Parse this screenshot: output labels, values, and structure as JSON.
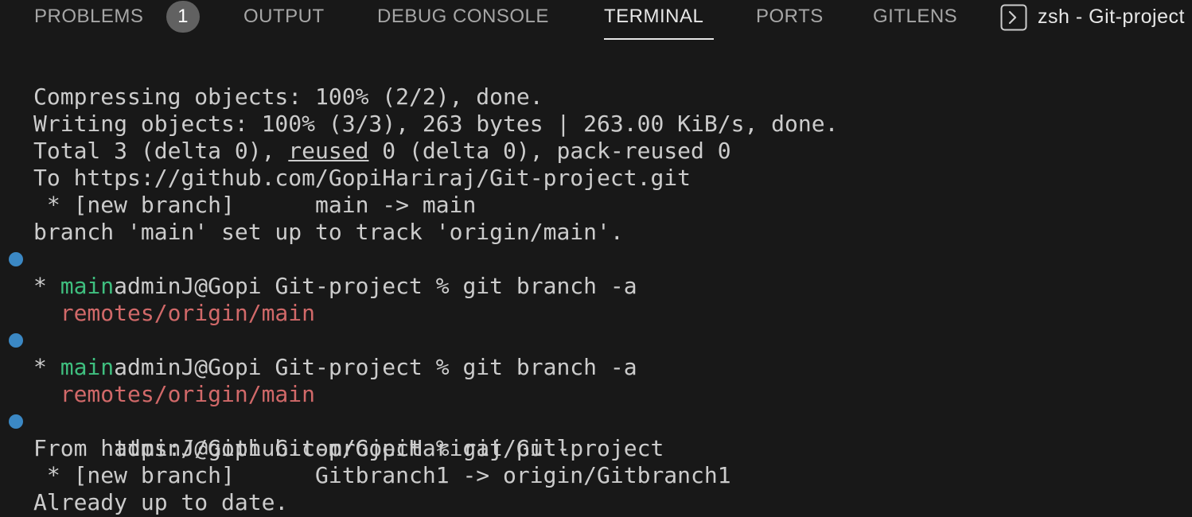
{
  "tabs": {
    "problems": "PROBLEMS",
    "problems_count": "1",
    "output": "OUTPUT",
    "debug_console": "DEBUG CONSOLE",
    "terminal": "TERMINAL",
    "ports": "PORTS",
    "gitlens": "GITLENS"
  },
  "terminal_instance": {
    "icon": "terminal-icon",
    "title": "zsh - Git-project"
  },
  "colors": {
    "background": "#181818",
    "text": "#cccccc",
    "branch_current": "#3fbf7f",
    "branch_remote": "#d16969",
    "prompt_dot": "#3b88c4",
    "active_tab": "#e7e7e7"
  },
  "output": {
    "l1": "Compressing objects: 100% (2/2), done.",
    "l2": "Writing objects: 100% (3/3), 263 bytes | 263.00 KiB/s, done.",
    "l3_pre": "Total 3 (delta 0), ",
    "l3_link": "reused",
    "l3_post": " 0 (delta 0), pack-reused 0",
    "l4": "To https://github.com/GopiHariraj/Git-project.git",
    "l5": " * [new branch]      main -> main",
    "l6": "branch 'main' set up to track 'origin/main'.",
    "l7": "adminJ@Gopi Git-project % git branch -a",
    "l8_star": "* ",
    "l8_branch": "main",
    "l9": "  remotes/origin/main",
    "l10": "adminJ@Gopi Git-project % git branch -a",
    "l11_star": "* ",
    "l11_branch": "main",
    "l12": "  remotes/origin/main",
    "l13": "adminJ@Gopi Git-project % git pull",
    "l14": "From https://github.com/GopiHariraj/Git-project",
    "l15": " * [new branch]      Gitbranch1 -> origin/Gitbranch1",
    "l16": "Already up to date."
  }
}
